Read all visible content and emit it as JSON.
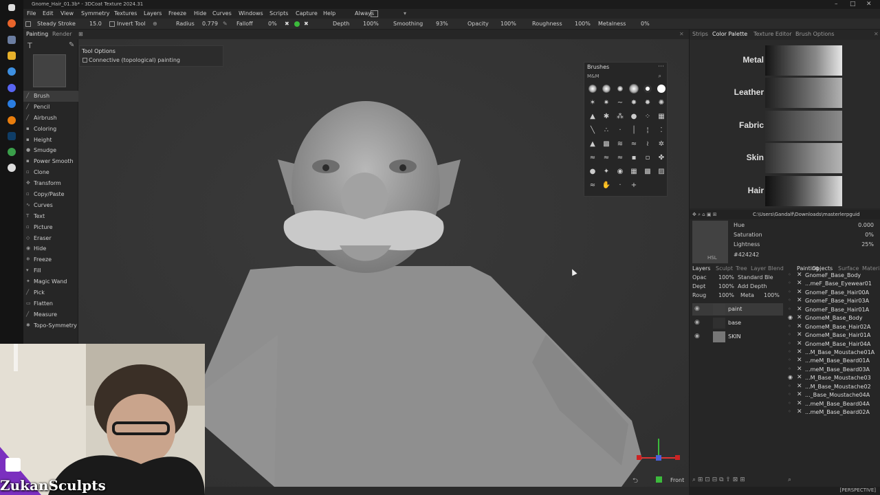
{
  "titlebar": {
    "title": "Gnome_Hair_01.3b* - 3DCoat Texture 2024.31",
    "buttons": [
      "–",
      "□",
      "✕"
    ]
  },
  "menu": {
    "items": [
      "File",
      "Edit",
      "View",
      "Symmetry",
      "Textures",
      "Layers",
      "Freeze",
      "Hide",
      "Curves",
      "Windows",
      "Scripts",
      "Capture",
      "Help"
    ],
    "always_label": "Always"
  },
  "toolbar": {
    "steady_stroke": "Steady Stroke",
    "steady_value": "15.0",
    "invert_tool": "Invert Tool",
    "radius_label": "Radius",
    "radius_value": "0.779",
    "falloff_label": "Falloff",
    "falloff_value": "0%",
    "depth_label": "Depth",
    "depth_value": "100%",
    "smoothing_label": "Smoothing",
    "smoothing_value": "93%",
    "opacity_label": "Opacity",
    "opacity_value": "100%",
    "roughness_label": "Roughness",
    "roughness_value": "100%",
    "metalness_label": "Metalness",
    "metalness_value": "0%"
  },
  "room_tabs": [
    "Painting",
    "Render"
  ],
  "right_tabs": [
    "Strips",
    "Color Palette",
    "Texture Editor",
    "Brush Options"
  ],
  "tools": [
    "Brush",
    "Pencil",
    "Airbrush",
    "Coloring",
    "Height",
    "Smudge",
    "Power Smooth",
    "Clone",
    "Transform",
    "Copy/Paste",
    "Curves",
    "Text",
    "Picture",
    "Eraser",
    "Hide",
    "Freeze",
    "Fill",
    "Magic Wand",
    "Pick",
    "Flatten",
    "Measure",
    "Topo-Symmetry"
  ],
  "tool_options": {
    "title": "Tool Options",
    "connective_label": "Connective (topological) painting"
  },
  "brushes": {
    "title": "Brushes",
    "set": "M&M"
  },
  "palette": {
    "rows": [
      "Metal",
      "Leather",
      "Fabric",
      "Skin",
      "Hair"
    ]
  },
  "color": {
    "path": "C:\\Users\\Gandalf\\Downloads\\masterlerpguid",
    "hue_label": "Hue",
    "hue_value": "0.000",
    "saturation_label": "Saturation",
    "saturation_value": "0%",
    "lightness_label": "Lightness",
    "lightness_value": "25%",
    "hex": "#424242",
    "mode": "HSL",
    "swatch": "#424242"
  },
  "layers_panel": {
    "tabs": [
      "Layers",
      "Sculpt",
      "Tree",
      "Layer",
      "Blend"
    ],
    "opacity": "100%",
    "blend": "Standard Ble",
    "depth": "100%",
    "depth_mode": "Add Depth",
    "rough": "100%",
    "meta_label": "Meta",
    "meta": "100%",
    "opac_label": "Opac",
    "dept_label": "Dept",
    "roug_label": "Roug",
    "layers": [
      "paint",
      "base",
      "SKIN"
    ]
  },
  "objects_panel": {
    "tabs": [
      "Painting",
      "Objects",
      "Surface",
      "Materi"
    ],
    "objects": [
      "GnomeF_Base_Body",
      "...meF_Base_Eyewear01",
      "GnomeF_Base_Hair00A",
      "GnomeF_Base_Hair03A",
      "GnomeF_Base_Hair01A",
      "GnomeM_Base_Body",
      "GnomeM_Base_Hair02A",
      "GnomeM_Base_Hair01A",
      "GnomeM_Base_Hair04A",
      "...M_Base_Moustache01A",
      "...meM_Base_Beard01A",
      "...meM_Base_Beard03A",
      "...M_Base_Moustache03",
      "...M_Base_Moustache02",
      "..._Base_Moustache04A",
      "...meM_Base_Beard04A",
      "...meM_Base_Beard02A"
    ]
  },
  "viewport": {
    "view_label": "Front",
    "projection": "[PERSPECTIVE]"
  },
  "stream": {
    "streamer": "ZukanSculpts"
  }
}
